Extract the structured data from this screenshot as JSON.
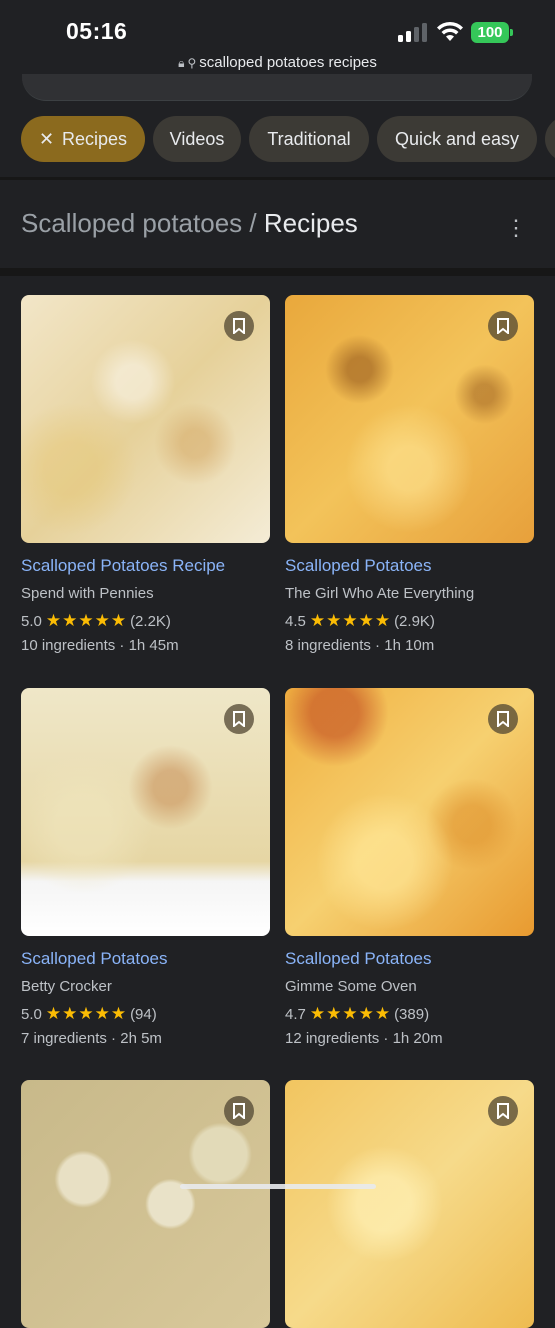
{
  "status_bar": {
    "time": "05:16",
    "battery": "100"
  },
  "browser": {
    "url": "scalloped potatoes recipes"
  },
  "chips": [
    {
      "label": "Recipes",
      "active": true
    },
    {
      "label": "Videos",
      "active": false
    },
    {
      "label": "Traditional",
      "active": false
    },
    {
      "label": "Quick and easy",
      "active": false
    }
  ],
  "heading": {
    "parent": "Scalloped potatoes",
    "separator": " / ",
    "current": "Recipes"
  },
  "recipes": [
    {
      "title": "Scalloped Potatoes Recipe",
      "source": "Spend with Pennies",
      "rating": "5.0",
      "stars": "★★★★★",
      "reviews": "(2.2K)",
      "meta": "10 ingredients · 1h 45m"
    },
    {
      "title": "Scalloped Potatoes",
      "source": "The Girl Who Ate Everything",
      "rating": "4.5",
      "stars": "★★★★★",
      "reviews": "(2.9K)",
      "meta": "8 ingredients · 1h 10m"
    },
    {
      "title": "Scalloped Potatoes",
      "source": "Betty Crocker",
      "rating": "5.0",
      "stars": "★★★★★",
      "reviews": "(94)",
      "meta": "7 ingredients · 2h 5m"
    },
    {
      "title": "Scalloped Potatoes",
      "source": "Gimme Some Oven",
      "rating": "4.7",
      "stars": "★★★★★",
      "reviews": "(389)",
      "meta": "12 ingredients · 1h 20m"
    },
    {
      "title": "",
      "source": "",
      "rating": "",
      "stars": "",
      "reviews": "",
      "meta": ""
    },
    {
      "title": "",
      "source": "",
      "rating": "",
      "stars": "",
      "reviews": "",
      "meta": ""
    }
  ],
  "icons": {
    "chip_close": "close-icon",
    "bookmark": "bookmark-icon",
    "more": "more-vert-icon"
  },
  "colors": {
    "background": "#202124",
    "link": "#8ab4f8",
    "star": "#fbbc04",
    "active_chip": "#8b6a1e"
  }
}
